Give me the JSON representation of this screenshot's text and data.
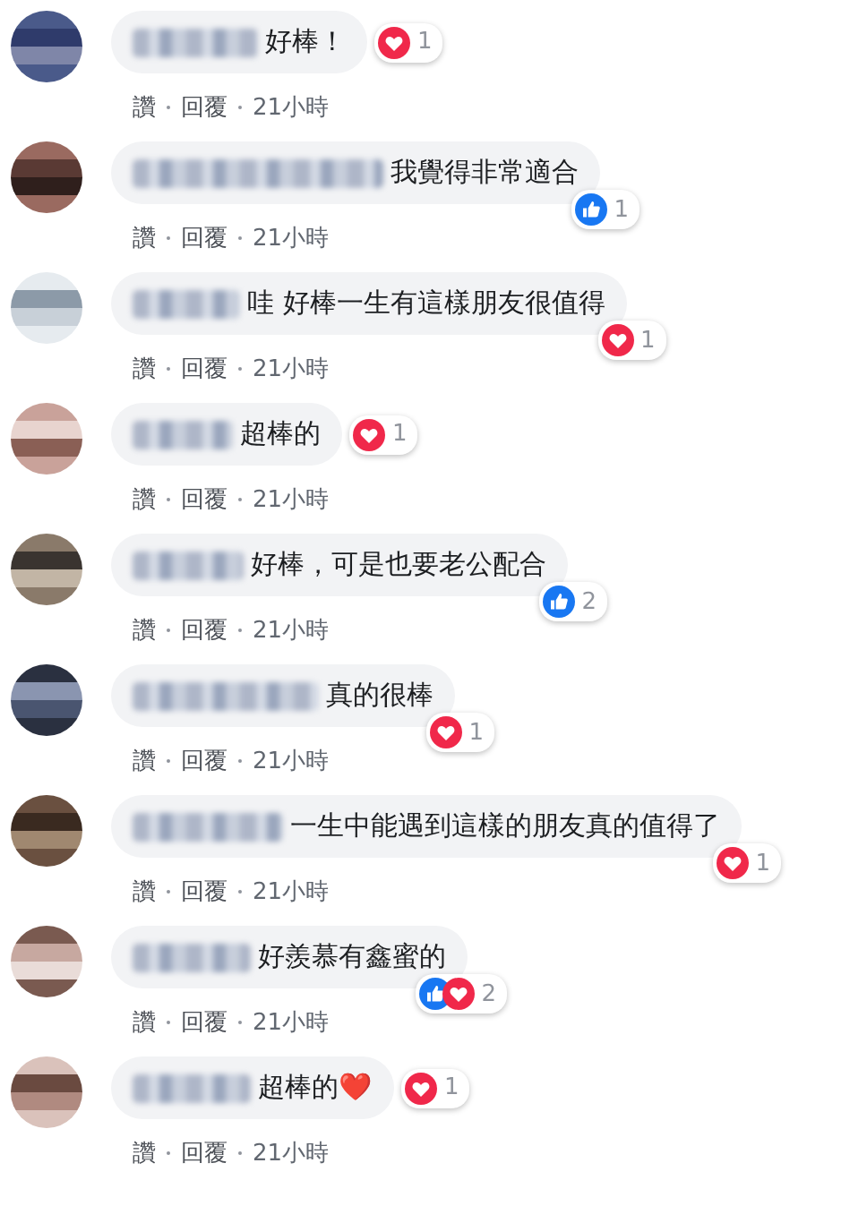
{
  "comments": [
    {
      "text": "好棒！",
      "like": "讚",
      "reply": "回覆",
      "time": "21小時",
      "reactions": {
        "overlaps_bubble": false,
        "icons": [
          {
            "kind": "heart"
          }
        ],
        "count": "1"
      }
    },
    {
      "text": "我覺得非常適合",
      "like": "讚",
      "reply": "回覆",
      "time": "21小時",
      "reactions": {
        "overlaps_bubble": true,
        "icons": [
          {
            "kind": "like"
          }
        ],
        "count": "1"
      }
    },
    {
      "text": "哇 好棒一生有這樣朋友很值得",
      "like": "讚",
      "reply": "回覆",
      "time": "21小時",
      "reactions": {
        "overlaps_bubble": true,
        "icons": [
          {
            "kind": "heart"
          }
        ],
        "count": "1"
      }
    },
    {
      "text": "超棒的",
      "like": "讚",
      "reply": "回覆",
      "time": "21小時",
      "reactions": {
        "overlaps_bubble": false,
        "icons": [
          {
            "kind": "heart"
          }
        ],
        "count": "1"
      }
    },
    {
      "text": "好棒，可是也要老公配合",
      "like": "讚",
      "reply": "回覆",
      "time": "21小時",
      "reactions": {
        "overlaps_bubble": true,
        "icons": [
          {
            "kind": "like"
          }
        ],
        "count": "2"
      }
    },
    {
      "text": "真的很棒",
      "like": "讚",
      "reply": "回覆",
      "time": "21小時",
      "reactions": {
        "overlaps_bubble": true,
        "icons": [
          {
            "kind": "heart"
          }
        ],
        "count": "1"
      }
    },
    {
      "text": "一生中能遇到這樣的朋友真的值得了",
      "like": "讚",
      "reply": "回覆",
      "time": "21小時",
      "reactions": {
        "overlaps_bubble": true,
        "icons": [
          {
            "kind": "heart"
          }
        ],
        "count": "1"
      }
    },
    {
      "text": "好羨慕有鑫蜜的",
      "like": "讚",
      "reply": "回覆",
      "time": "21小時",
      "reactions": {
        "overlaps_bubble": true,
        "icons": [
          {
            "kind": "like"
          },
          {
            "kind": "heart"
          }
        ],
        "count": "2"
      }
    },
    {
      "text": "超棒的❤️",
      "like": "讚",
      "reply": "回覆",
      "time": "21小時",
      "reactions": {
        "overlaps_bubble": false,
        "icons": [
          {
            "kind": "heart"
          }
        ],
        "count": "1"
      }
    }
  ]
}
